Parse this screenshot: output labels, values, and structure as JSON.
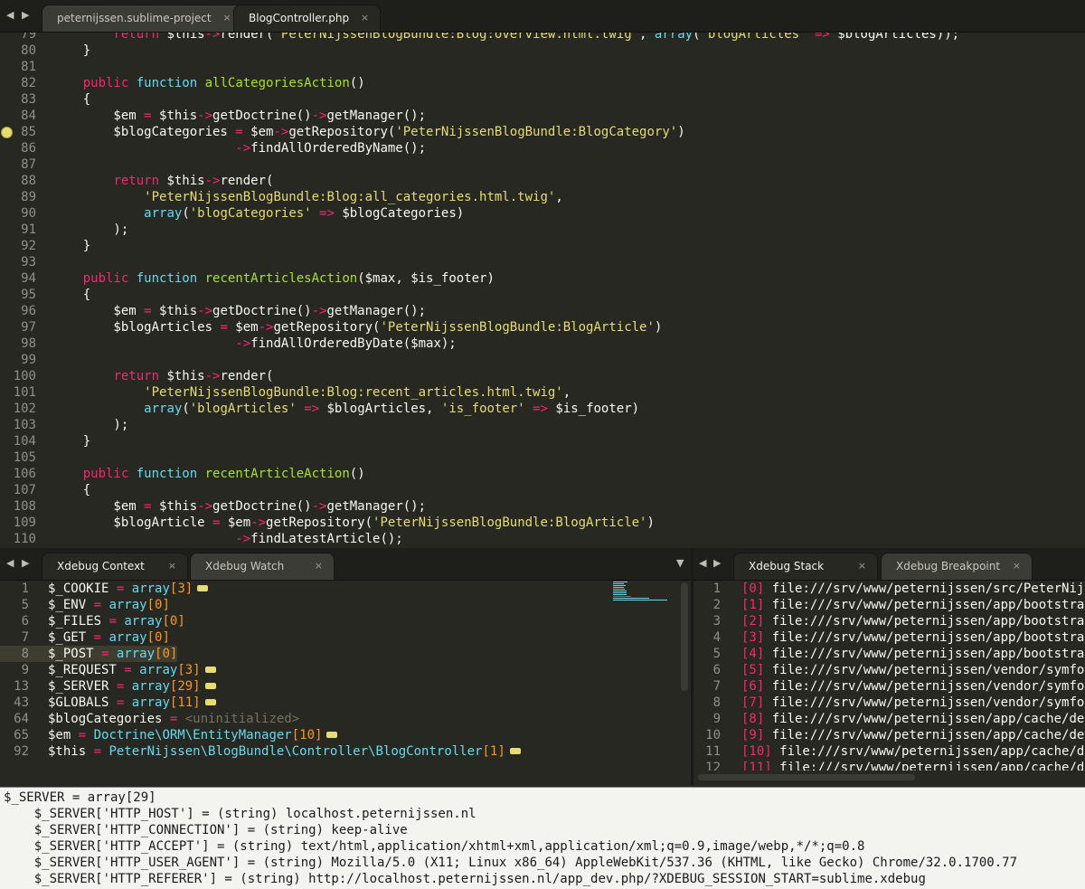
{
  "top_tabs": [
    {
      "label": "peternijssen.sublime-project",
      "close": "×"
    },
    {
      "label": "BlogController.php",
      "close": "×"
    }
  ],
  "editor": {
    "lines": [
      {
        "num": "79",
        "code": [
          [
            "        ",
            "w"
          ],
          [
            "return",
            "k"
          ],
          [
            " $this",
            "w"
          ],
          [
            "->",
            "k"
          ],
          [
            "render(",
            "w"
          ],
          [
            "'PeterNijssenBlogBundle:Blog:overview.html.twig'",
            "s"
          ],
          [
            ", ",
            "w"
          ],
          [
            "array",
            "f"
          ],
          [
            "(",
            "w"
          ],
          [
            "'blogArticles'",
            "s"
          ],
          [
            " => ",
            "k"
          ],
          [
            "$blogArticles));",
            "w"
          ]
        ]
      },
      {
        "num": "80",
        "code": [
          [
            "    }",
            "w"
          ]
        ]
      },
      {
        "num": "81",
        "code": []
      },
      {
        "num": "82",
        "code": [
          [
            "    ",
            "w"
          ],
          [
            "public",
            "k"
          ],
          [
            " ",
            "w"
          ],
          [
            "function",
            "f"
          ],
          [
            " ",
            "w"
          ],
          [
            "allCategoriesAction",
            "n"
          ],
          [
            "()",
            "w"
          ]
        ]
      },
      {
        "num": "83",
        "code": [
          [
            "    {",
            "w"
          ]
        ]
      },
      {
        "num": "84",
        "code": [
          [
            "        $em ",
            "w"
          ],
          [
            "=",
            "k"
          ],
          [
            " $this",
            "w"
          ],
          [
            "->",
            "k"
          ],
          [
            "getDoctrine()",
            "w"
          ],
          [
            "->",
            "k"
          ],
          [
            "getManager();",
            "w"
          ]
        ]
      },
      {
        "num": "85",
        "code": [
          [
            "        $blogCategories ",
            "w"
          ],
          [
            "=",
            "k"
          ],
          [
            " $em",
            "w"
          ],
          [
            "->",
            "k"
          ],
          [
            "getRepository(",
            "w"
          ],
          [
            "'PeterNijssenBlogBundle:BlogCategory'",
            "s"
          ],
          [
            ")",
            "w"
          ]
        ]
      },
      {
        "num": "86",
        "code": [
          [
            "                        ",
            "w"
          ],
          [
            "->",
            "k"
          ],
          [
            "findAllOrderedByName();",
            "w"
          ]
        ]
      },
      {
        "num": "87",
        "code": []
      },
      {
        "num": "88",
        "code": [
          [
            "        ",
            "w"
          ],
          [
            "return",
            "k"
          ],
          [
            " $this",
            "w"
          ],
          [
            "->",
            "k"
          ],
          [
            "render(",
            "w"
          ]
        ]
      },
      {
        "num": "89",
        "code": [
          [
            "            ",
            "w"
          ],
          [
            "'PeterNijssenBlogBundle:Blog:all_categories.html.twig'",
            "s"
          ],
          [
            ",",
            "w"
          ]
        ]
      },
      {
        "num": "90",
        "code": [
          [
            "            ",
            "w"
          ],
          [
            "array",
            "f"
          ],
          [
            "(",
            "w"
          ],
          [
            "'blogCategories'",
            "s"
          ],
          [
            " => ",
            "k"
          ],
          [
            "$blogCategories)",
            "w"
          ]
        ]
      },
      {
        "num": "91",
        "code": [
          [
            "        );",
            "w"
          ]
        ]
      },
      {
        "num": "92",
        "code": [
          [
            "    }",
            "w"
          ]
        ]
      },
      {
        "num": "93",
        "code": []
      },
      {
        "num": "94",
        "code": [
          [
            "    ",
            "w"
          ],
          [
            "public",
            "k"
          ],
          [
            " ",
            "w"
          ],
          [
            "function",
            "f"
          ],
          [
            " ",
            "w"
          ],
          [
            "recentArticlesAction",
            "n"
          ],
          [
            "($max, $is_footer)",
            "w"
          ]
        ]
      },
      {
        "num": "95",
        "code": [
          [
            "    {",
            "w"
          ]
        ]
      },
      {
        "num": "96",
        "code": [
          [
            "        $em ",
            "w"
          ],
          [
            "=",
            "k"
          ],
          [
            " $this",
            "w"
          ],
          [
            "->",
            "k"
          ],
          [
            "getDoctrine()",
            "w"
          ],
          [
            "->",
            "k"
          ],
          [
            "getManager();",
            "w"
          ]
        ]
      },
      {
        "num": "97",
        "code": [
          [
            "        $blogArticles ",
            "w"
          ],
          [
            "=",
            "k"
          ],
          [
            " $em",
            "w"
          ],
          [
            "->",
            "k"
          ],
          [
            "getRepository(",
            "w"
          ],
          [
            "'PeterNijssenBlogBundle:BlogArticle'",
            "s"
          ],
          [
            ")",
            "w"
          ]
        ]
      },
      {
        "num": "98",
        "code": [
          [
            "                        ",
            "w"
          ],
          [
            "->",
            "k"
          ],
          [
            "findAllOrderedByDate($max);",
            "w"
          ]
        ]
      },
      {
        "num": "99",
        "code": []
      },
      {
        "num": "100",
        "code": [
          [
            "        ",
            "w"
          ],
          [
            "return",
            "k"
          ],
          [
            " $this",
            "w"
          ],
          [
            "->",
            "k"
          ],
          [
            "render(",
            "w"
          ]
        ]
      },
      {
        "num": "101",
        "code": [
          [
            "            ",
            "w"
          ],
          [
            "'PeterNijssenBlogBundle:Blog:recent_articles.html.twig'",
            "s"
          ],
          [
            ",",
            "w"
          ]
        ]
      },
      {
        "num": "102",
        "code": [
          [
            "            ",
            "w"
          ],
          [
            "array",
            "f"
          ],
          [
            "(",
            "w"
          ],
          [
            "'blogArticles'",
            "s"
          ],
          [
            " => ",
            "k"
          ],
          [
            "$blogArticles, ",
            "w"
          ],
          [
            "'is_footer'",
            "s"
          ],
          [
            " => ",
            "k"
          ],
          [
            "$is_footer)",
            "w"
          ]
        ]
      },
      {
        "num": "103",
        "code": [
          [
            "        );",
            "w"
          ]
        ]
      },
      {
        "num": "104",
        "code": [
          [
            "    }",
            "w"
          ]
        ]
      },
      {
        "num": "105",
        "code": []
      },
      {
        "num": "106",
        "code": [
          [
            "    ",
            "w"
          ],
          [
            "public",
            "k"
          ],
          [
            " ",
            "w"
          ],
          [
            "function",
            "f"
          ],
          [
            " ",
            "w"
          ],
          [
            "recentArticleAction",
            "n"
          ],
          [
            "()",
            "w"
          ]
        ]
      },
      {
        "num": "107",
        "code": [
          [
            "    {",
            "w"
          ]
        ]
      },
      {
        "num": "108",
        "code": [
          [
            "        $em ",
            "w"
          ],
          [
            "=",
            "k"
          ],
          [
            " $this",
            "w"
          ],
          [
            "->",
            "k"
          ],
          [
            "getDoctrine()",
            "w"
          ],
          [
            "->",
            "k"
          ],
          [
            "getManager();",
            "w"
          ]
        ]
      },
      {
        "num": "109",
        "code": [
          [
            "        $blogArticle ",
            "w"
          ],
          [
            "=",
            "k"
          ],
          [
            " $em",
            "w"
          ],
          [
            "->",
            "k"
          ],
          [
            "getRepository(",
            "w"
          ],
          [
            "'PeterNijssenBlogBundle:BlogArticle'",
            "s"
          ],
          [
            ")",
            "w"
          ]
        ]
      },
      {
        "num": "110",
        "code": [
          [
            "                        ",
            "w"
          ],
          [
            "->",
            "k"
          ],
          [
            "findLatestArticle();",
            "w"
          ]
        ]
      }
    ]
  },
  "context_tabs": [
    {
      "label": "Xdebug Context",
      "close": "×"
    },
    {
      "label": "Xdebug Watch",
      "close": "×"
    }
  ],
  "context": {
    "lines": [
      {
        "num": "1",
        "code": [
          [
            "$_COOKIE ",
            "w"
          ],
          [
            "=",
            "k"
          ],
          [
            " ",
            "w"
          ],
          [
            "array",
            "f"
          ],
          [
            "[3]",
            "v"
          ]
        ],
        "ellipsis": true
      },
      {
        "num": "5",
        "code": [
          [
            "$_ENV ",
            "w"
          ],
          [
            "=",
            "k"
          ],
          [
            " ",
            "w"
          ],
          [
            "array",
            "f"
          ],
          [
            "[0]",
            "v"
          ]
        ]
      },
      {
        "num": "6",
        "code": [
          [
            "$_FILES ",
            "w"
          ],
          [
            "=",
            "k"
          ],
          [
            " ",
            "w"
          ],
          [
            "array",
            "f"
          ],
          [
            "[0]",
            "v"
          ]
        ]
      },
      {
        "num": "7",
        "code": [
          [
            "$_GET ",
            "w"
          ],
          [
            "=",
            "k"
          ],
          [
            " ",
            "w"
          ],
          [
            "array",
            "f"
          ],
          [
            "[0]",
            "v"
          ]
        ]
      },
      {
        "num": "8",
        "code": [
          [
            "$_POST ",
            "w"
          ],
          [
            "=",
            "k"
          ],
          [
            " ",
            "w"
          ],
          [
            "array",
            "f"
          ],
          [
            "[0]",
            "v"
          ]
        ]
      },
      {
        "num": "9",
        "code": [
          [
            "$_REQUEST ",
            "w"
          ],
          [
            "=",
            "k"
          ],
          [
            " ",
            "w"
          ],
          [
            "array",
            "f"
          ],
          [
            "[3]",
            "v"
          ]
        ],
        "ellipsis": true
      },
      {
        "num": "13",
        "code": [
          [
            "$_SERVER ",
            "w"
          ],
          [
            "=",
            "k"
          ],
          [
            " ",
            "w"
          ],
          [
            "array",
            "f"
          ],
          [
            "[29]",
            "v"
          ]
        ],
        "ellipsis": true
      },
      {
        "num": "43",
        "code": [
          [
            "$GLOBALS ",
            "w"
          ],
          [
            "=",
            "k"
          ],
          [
            " ",
            "w"
          ],
          [
            "array",
            "f"
          ],
          [
            "[11]",
            "v"
          ]
        ],
        "ellipsis": true
      },
      {
        "num": "64",
        "code": [
          [
            "$blogCategories ",
            "w"
          ],
          [
            "=",
            "k"
          ],
          [
            " ",
            "w"
          ],
          [
            "<uninitialized>",
            "c"
          ]
        ]
      },
      {
        "num": "65",
        "code": [
          [
            "$em ",
            "w"
          ],
          [
            "=",
            "k"
          ],
          [
            " ",
            "w"
          ],
          [
            "Doctrine\\ORM\\EntityManager",
            "f"
          ],
          [
            "[10]",
            "v"
          ]
        ],
        "ellipsis": true
      },
      {
        "num": "92",
        "code": [
          [
            "$this ",
            "w"
          ],
          [
            "=",
            "k"
          ],
          [
            " ",
            "w"
          ],
          [
            "PeterNijssen\\BlogBundle\\Controller\\BlogController",
            "f"
          ],
          [
            "[1]",
            "v"
          ]
        ],
        "ellipsis": true
      }
    ]
  },
  "stack_tabs": [
    {
      "label": "Xdebug Stack",
      "close": "×"
    },
    {
      "label": "Xdebug Breakpoint",
      "close": "×"
    }
  ],
  "stack": {
    "lines": [
      {
        "num": "1",
        "code": [
          [
            "[0]",
            "k"
          ],
          [
            " file:///srv/www/peternijssen/src/PeterNijssen/BlogBundle/Controller/BlogController.php",
            "w"
          ]
        ]
      },
      {
        "num": "2",
        "code": [
          [
            "[1]",
            "k"
          ],
          [
            " file:///srv/www/peternijssen/app/bootstrap.php.cache",
            "w"
          ]
        ]
      },
      {
        "num": "3",
        "code": [
          [
            "[2]",
            "k"
          ],
          [
            " file:///srv/www/peternijssen/app/bootstrap.php.cache",
            "w"
          ]
        ]
      },
      {
        "num": "4",
        "code": [
          [
            "[3]",
            "k"
          ],
          [
            " file:///srv/www/peternijssen/app/bootstrap.php.cache",
            "w"
          ]
        ]
      },
      {
        "num": "5",
        "code": [
          [
            "[4]",
            "k"
          ],
          [
            " file:///srv/www/peternijssen/app/bootstrap.php.cache",
            "w"
          ]
        ]
      },
      {
        "num": "6",
        "code": [
          [
            "[5]",
            "k"
          ],
          [
            " file:///srv/www/peternijssen/vendor/symfony/symfony/src",
            "w"
          ]
        ]
      },
      {
        "num": "7",
        "code": [
          [
            "[6]",
            "k"
          ],
          [
            " file:///srv/www/peternijssen/vendor/symfony/symfony/src",
            "w"
          ]
        ]
      },
      {
        "num": "8",
        "code": [
          [
            "[7]",
            "k"
          ],
          [
            " file:///srv/www/peternijssen/vendor/symfony/symfony/src",
            "w"
          ]
        ]
      },
      {
        "num": "9",
        "code": [
          [
            "[8]",
            "k"
          ],
          [
            " file:///srv/www/peternijssen/app/cache/dev/classes.php",
            "w"
          ]
        ]
      },
      {
        "num": "10",
        "code": [
          [
            "[9]",
            "k"
          ],
          [
            " file:///srv/www/peternijssen/app/cache/dev/classes.php",
            "w"
          ]
        ]
      },
      {
        "num": "11",
        "code": [
          [
            "[10]",
            "k"
          ],
          [
            " file:///srv/www/peternijssen/app/cache/dev/classes.php",
            "w"
          ]
        ]
      },
      {
        "num": "12",
        "code": [
          [
            "[11]",
            "k"
          ],
          [
            " file:///srv/www/peternijssen/app/cache/dev/classes.php",
            "w"
          ]
        ]
      }
    ]
  },
  "output": {
    "lines": [
      "$_SERVER = array[29]",
      "    $_SERVER['HTTP_HOST'] = (string) localhost.peternijssen.nl",
      "    $_SERVER['HTTP_CONNECTION'] = (string) keep-alive",
      "    $_SERVER['HTTP_ACCEPT'] = (string) text/html,application/xhtml+xml,application/xml;q=0.9,image/webp,*/*;q=0.8",
      "    $_SERVER['HTTP_USER_AGENT'] = (string) Mozilla/5.0 (X11; Linux x86_64) AppleWebKit/537.36 (KHTML, like Gecko) Chrome/32.0.1700.77",
      "    $_SERVER['HTTP_REFERER'] = (string) http://localhost.peternijssen.nl/app_dev.php/?XDEBUG_SESSION_START=sublime.xdebug"
    ]
  },
  "icons": {
    "nav_left": "◀",
    "nav_right": "▶",
    "dropdown": "▼"
  },
  "colors": {
    "background": "#272822",
    "keyword": "#f92672",
    "storage": "#66d9ef",
    "function_name": "#a6e22e",
    "string": "#e6db74",
    "number": "#fd971f",
    "breakpoint": "#e6db74"
  }
}
